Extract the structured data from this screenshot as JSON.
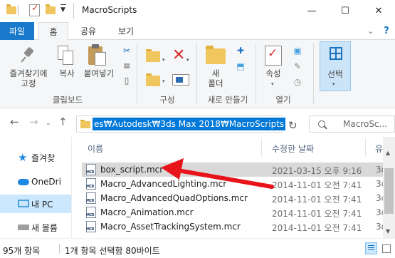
{
  "window": {
    "title": "MacroScripts",
    "minimize": "—",
    "maximize": "☐",
    "close": "✕"
  },
  "tabs": {
    "file": "파일",
    "home": "홈",
    "share": "공유",
    "view": "보기"
  },
  "ribbon": {
    "clipboard": {
      "pin_line1": "즐겨찾기에",
      "pin_line2": "고정",
      "copy": "복사",
      "paste": "붙여넣기",
      "group": "클립보드"
    },
    "organize": {
      "group": "구성"
    },
    "new": {
      "new_folder_line1": "새",
      "new_folder_line2": "폴더",
      "group": "새로 만들기"
    },
    "open": {
      "properties": "속성",
      "group": "열기"
    },
    "select": {
      "label": "선택"
    }
  },
  "address": {
    "path": "es₩Autodesk₩3ds Max 2018₩MacroScripts",
    "search_placeholder": "MacroSc..."
  },
  "nav_pane": {
    "items": [
      {
        "label": "즐겨찾",
        "icon": "star-icon"
      },
      {
        "label": "OneDri",
        "icon": "onedrive-icon"
      },
      {
        "label": "내 PC",
        "icon": "pc-icon"
      },
      {
        "label": "새 볼륨",
        "icon": "drive-icon"
      }
    ]
  },
  "file_list": {
    "columns": {
      "name": "이름",
      "date": "수정한 날짜",
      "type": "유"
    },
    "rows": [
      {
        "name": "box_script.mcr",
        "date": "2021-03-15 오후 9:16",
        "type": "3d"
      },
      {
        "name": "Macro_AdvancedLighting.mcr",
        "date": "2014-11-01 오전 7:41",
        "type": "3c"
      },
      {
        "name": "Macro_AdvancedQuadOptions.mcr",
        "date": "2014-11-01 오전 7:41",
        "type": "3c"
      },
      {
        "name": "Macro_Animation.mcr",
        "date": "2014-11-01 오전 7:41",
        "type": "3c"
      },
      {
        "name": "Macro_AssetTrackingSystem.mcr",
        "date": "2014-11-01 오전 7:41",
        "type": "3d"
      }
    ]
  },
  "status": {
    "item_count": "95개 항목",
    "selection": "1개 항목 선택함 80바이트"
  },
  "colors": {
    "accent": "#1979ca",
    "selection": "#0078d7",
    "annotation_arrow": "#e8141b"
  }
}
